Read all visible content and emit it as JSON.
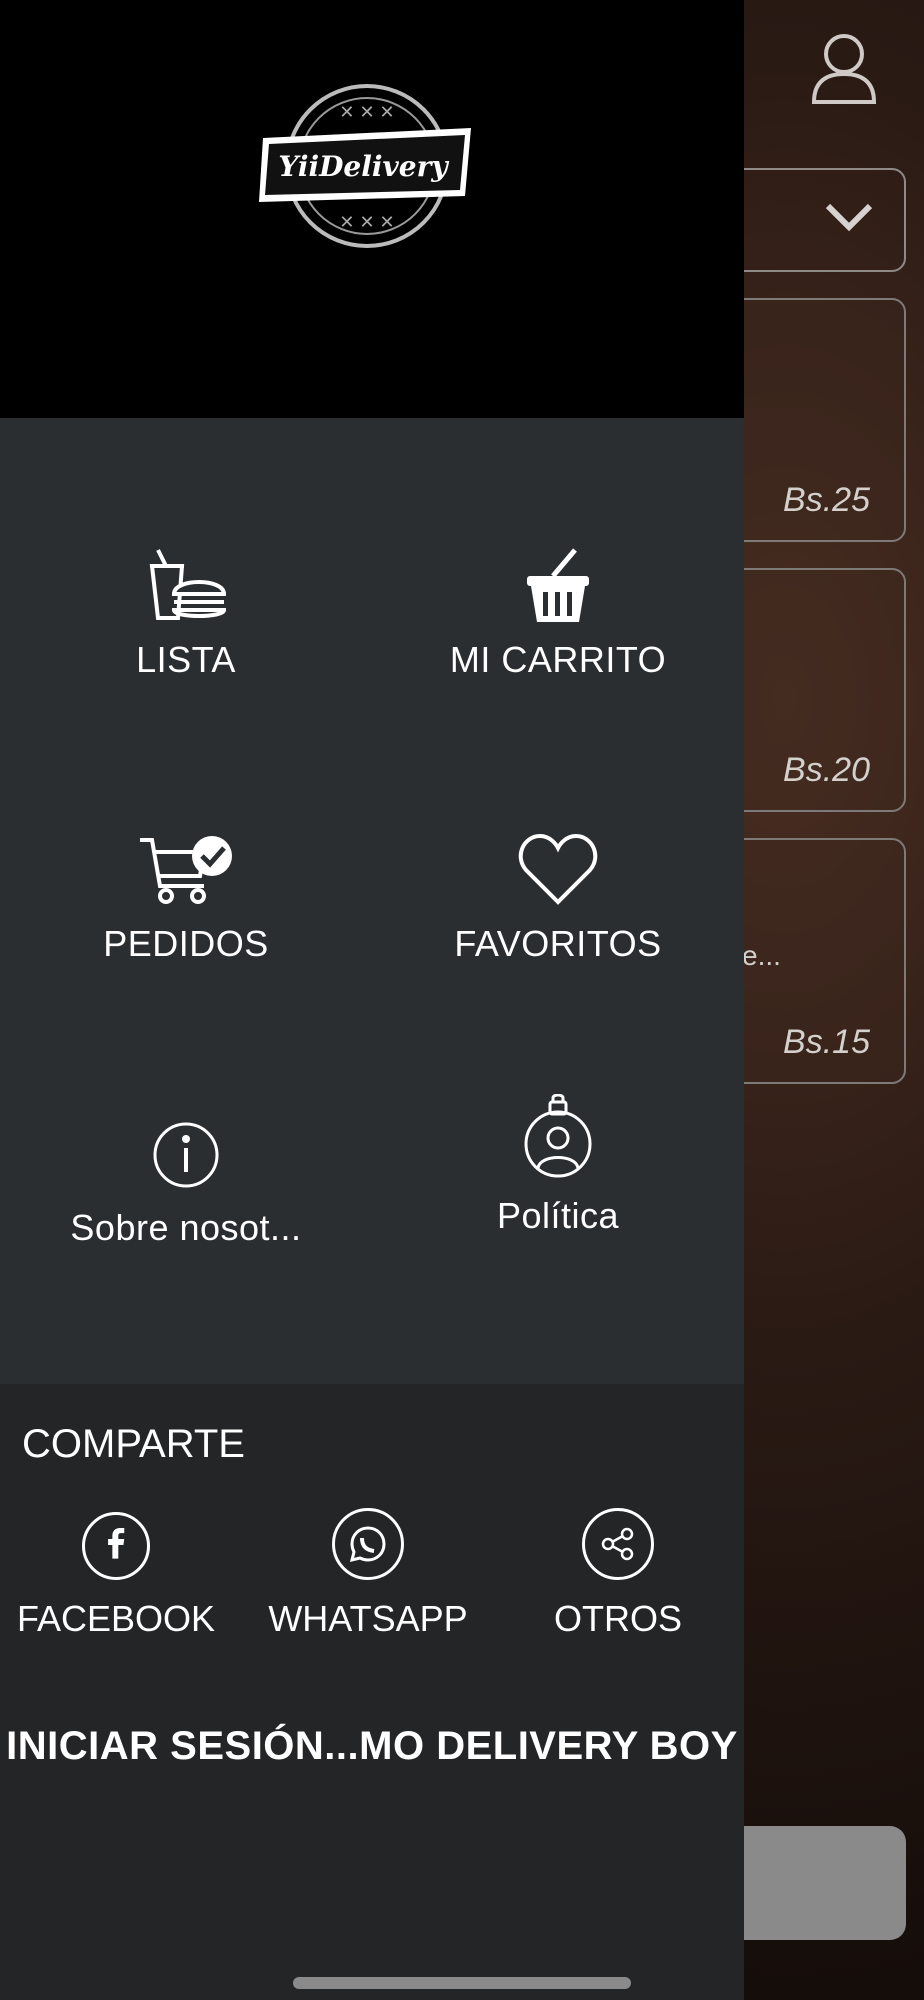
{
  "app": {
    "logo_text": "YiiDelivery"
  },
  "drawer": {
    "menu": [
      {
        "id": "lista",
        "label": "LISTA",
        "icon": "fastfood-icon"
      },
      {
        "id": "carrito",
        "label": "MI CARRITO",
        "icon": "basket-icon"
      },
      {
        "id": "pedidos",
        "label": "PEDIDOS",
        "icon": "cart-check-icon"
      },
      {
        "id": "favoritos",
        "label": "FAVORITOS",
        "icon": "heart-icon"
      },
      {
        "id": "sobre",
        "label": "Sobre nosot...",
        "icon": "info-icon"
      },
      {
        "id": "politica",
        "label": "Política",
        "icon": "privacy-icon"
      }
    ],
    "share": {
      "title": "COMPARTE",
      "items": [
        {
          "label": "FACEBOOK",
          "icon": "facebook-icon"
        },
        {
          "label": "WHATSAPP",
          "icon": "whatsapp-icon"
        },
        {
          "label": "OTROS",
          "icon": "share-icon"
        }
      ]
    },
    "login_label": "INICIAR SESIÓN...MO DELIVERY BOY"
  },
  "background": {
    "cards": [
      {
        "price": "Bs.25",
        "snippet": ""
      },
      {
        "price": "Bs.20",
        "snippet": ""
      },
      {
        "price": "Bs.15",
        "snippet": "e..."
      }
    ]
  }
}
